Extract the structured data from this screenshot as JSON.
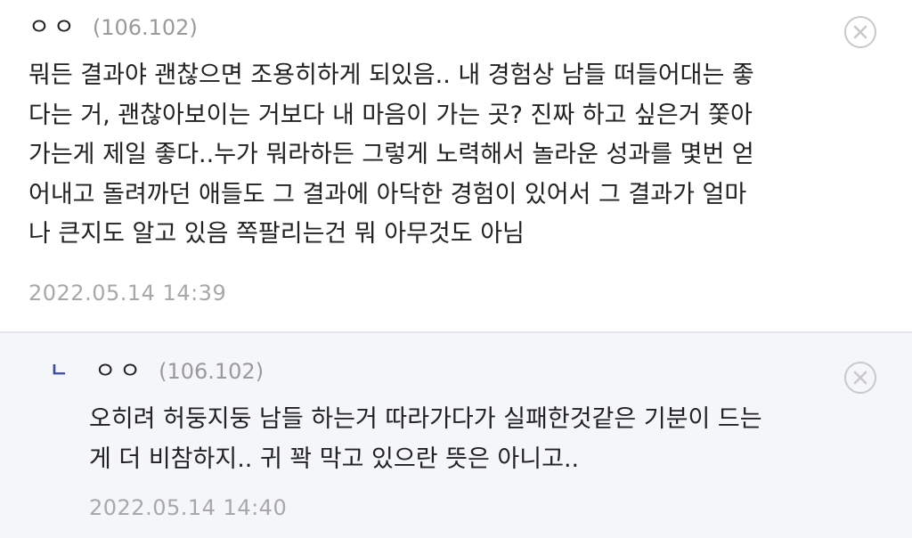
{
  "comments": [
    {
      "nick": "ㅇㅇ",
      "ip": "(106.102)",
      "body": "뭐든 결과야 괜찮으면 조용히하게 되있음.. 내 경험상 남들 떠들어대는 좋\n다는 거, 괜찮아보이는 거보다 내 마음이 가는 곳? 진짜 하고 싶은거 쫓아\n가는게 제일 좋다..누가 뭐라하든 그렇게 노력해서 놀라운 성과를 몇번 얻\n어내고 돌려까던 애들도 그 결과에 아닥한 경험이 있어서 그 결과가 얼마\n나 큰지도 알고 있음 쪽팔리는건 뭐 아무것도 아님",
      "timestamp": "2022.05.14 14:39",
      "close_icon": "close-circle-icon"
    }
  ],
  "reply": {
    "indicator": "ㄴ",
    "nick": "ㅇㅇ",
    "ip": "(106.102)",
    "body": "오히려 허둥지둥 남들 하는거 따라가다가 실패한것같은 기분이 드는\n게 더 비참하지.. 귀 꽉 막고 있으란 뜻은 아니고..",
    "timestamp": "2022.05.14 14:40",
    "close_icon": "close-circle-icon"
  },
  "colors": {
    "reply_background": "#f4f6fa",
    "reply_indicator": "#3a4aa0",
    "muted_text": "#9a9a9a"
  }
}
